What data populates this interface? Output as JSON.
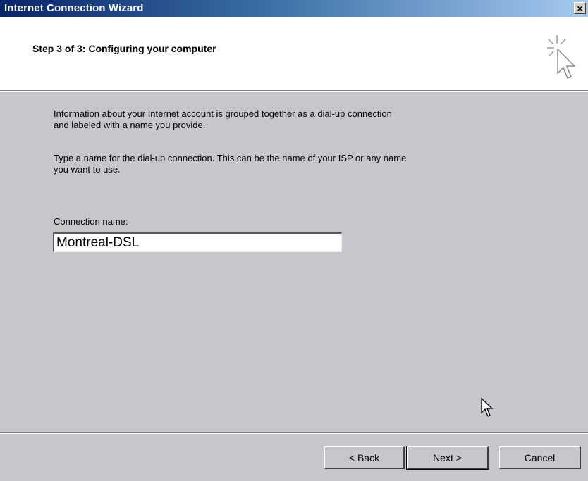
{
  "window": {
    "title": "Internet Connection Wizard",
    "close_icon": "close-icon"
  },
  "header": {
    "step_title": "Step 3 of 3: Configuring your computer",
    "icon": "wizard-cursor-sparkle-icon"
  },
  "body": {
    "paragraph1_line1": "Information about your Internet account is grouped together as a dial-up connection",
    "paragraph1_line2": "and labeled with a name you provide.",
    "paragraph2_line1": "Type a name for the dial-up connection. This can be the name of your ISP or any name",
    "paragraph2_line2": "you want to use.",
    "connection_name_label": "Connection name:",
    "connection_name_value": "Montreal-DSL"
  },
  "buttons": {
    "back": "< Back",
    "next": "Next >",
    "cancel": "Cancel"
  },
  "colors": {
    "title_bar_start": "#0a246a",
    "title_bar_end": "#a6caf0",
    "dialog_face": "#c8c6cc",
    "header_background": "#ffffff"
  }
}
